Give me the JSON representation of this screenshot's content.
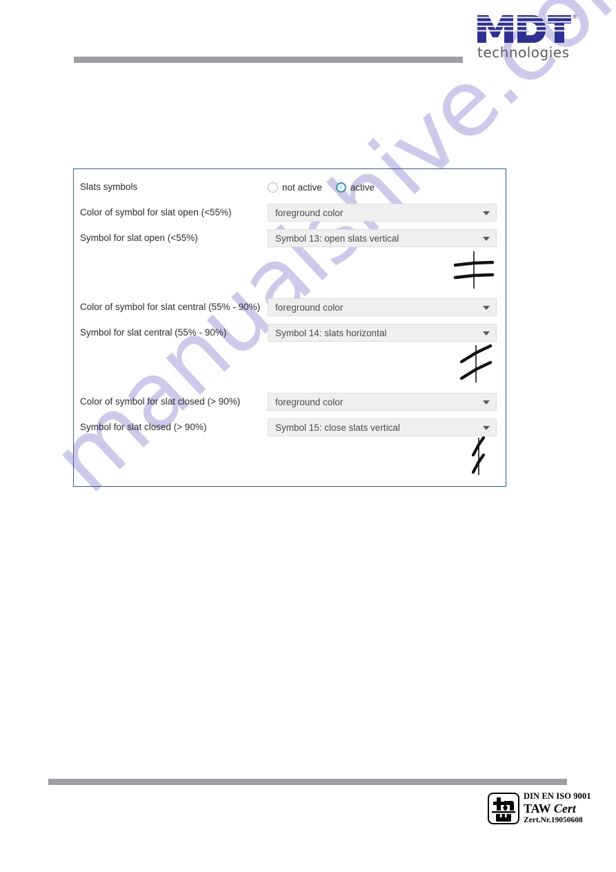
{
  "header": {
    "logo_text": "MDT",
    "logo_registered": "®",
    "logo_tagline": "technologies"
  },
  "watermark": {
    "text": "manualshive.com",
    "color": "#b9b5e4"
  },
  "panel": {
    "border_color": "#2e5f8a",
    "rows": [
      {
        "label": "Slats symbols",
        "type": "radio",
        "options": [
          {
            "label": "not active",
            "selected": false
          },
          {
            "label": "active",
            "selected": true
          }
        ]
      },
      {
        "label": "Color of symbol for slat open (<55%)",
        "type": "select",
        "value": "foreground color"
      },
      {
        "label": "Symbol for slat open (<55%)",
        "type": "select",
        "value": "Symbol 13: open slats vertical",
        "preview": "slats-open-vertical-icon"
      },
      {
        "label": "Color of symbol for slat central (55% - 90%)",
        "type": "select",
        "value": "foreground color"
      },
      {
        "label": "Symbol for slat central (55% - 90%)",
        "type": "select",
        "value": "Symbol 14: slats horizontal",
        "preview": "slats-horizontal-icon"
      },
      {
        "label": "Color of symbol for slat closed (> 90%)",
        "type": "select",
        "value": "foreground color"
      },
      {
        "label": "Symbol for slat closed (> 90%)",
        "type": "select",
        "value": "Symbol 15: close slats vertical",
        "preview": "slats-closed-vertical-icon"
      }
    ]
  },
  "footer": {
    "cert_line1": "DIN EN ISO 9001",
    "cert_line2_a": "TAW ",
    "cert_line2_b": "Cert",
    "cert_line3": "Zert.Nr.19050608"
  }
}
